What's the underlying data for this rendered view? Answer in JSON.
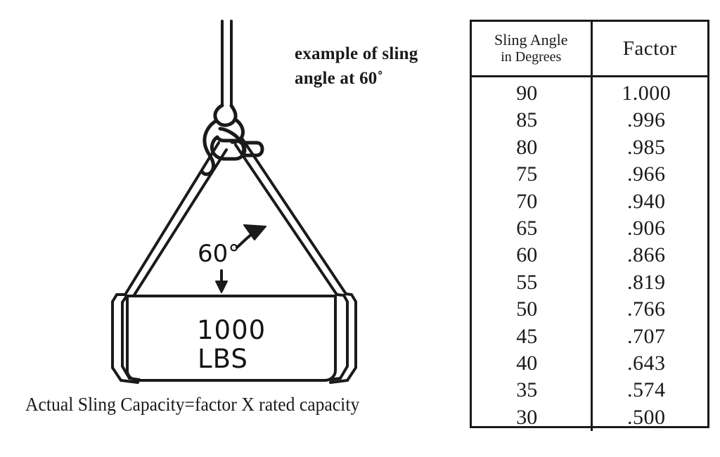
{
  "diagram": {
    "note": {
      "line1": "example of sling",
      "line2": "angle at 60˚"
    },
    "angle_label": "60°",
    "load": {
      "amount": "1000",
      "unit": "LBS"
    },
    "caption": "Actual Sling Capacity=factor X rated capacity",
    "icons": {
      "cable": "cable-icon",
      "hook": "hook-icon",
      "shackle": "shackle-icon",
      "sling-left": "sling-leg-left-icon",
      "sling-right": "sling-leg-right-icon",
      "load-block": "load-block-icon",
      "arrow-up": "curved-arrow-up-right-icon",
      "arrow-down": "arrow-down-icon"
    },
    "colors": {
      "ink": "#1a1a1a",
      "background": "#ffffff"
    }
  },
  "table": {
    "headers": {
      "angle_line1": "Sling Angle",
      "angle_line2": "in Degrees",
      "factor": "Factor"
    },
    "rows": [
      {
        "angle": "90",
        "factor": "1.000"
      },
      {
        "angle": "85",
        "factor": ".996"
      },
      {
        "angle": "80",
        "factor": ".985"
      },
      {
        "angle": "75",
        "factor": ".966"
      },
      {
        "angle": "70",
        "factor": ".940"
      },
      {
        "angle": "65",
        "factor": ".906"
      },
      {
        "angle": "60",
        "factor": ".866"
      },
      {
        "angle": "55",
        "factor": ".819"
      },
      {
        "angle": "50",
        "factor": ".766"
      },
      {
        "angle": "45",
        "factor": ".707"
      },
      {
        "angle": "40",
        "factor": ".643"
      },
      {
        "angle": "35",
        "factor": ".574"
      },
      {
        "angle": "30",
        "factor": ".500"
      }
    ]
  },
  "chart_data": {
    "type": "table",
    "title": "Sling Angle Factor Table",
    "columns": [
      "Sling Angle in Degrees",
      "Factor"
    ],
    "categories": [
      90,
      85,
      80,
      75,
      70,
      65,
      60,
      55,
      50,
      45,
      40,
      35,
      30
    ],
    "values": [
      1.0,
      0.996,
      0.985,
      0.966,
      0.94,
      0.906,
      0.866,
      0.819,
      0.766,
      0.707,
      0.643,
      0.574,
      0.5
    ],
    "xlabel": "Sling Angle in Degrees",
    "ylabel": "Factor"
  }
}
